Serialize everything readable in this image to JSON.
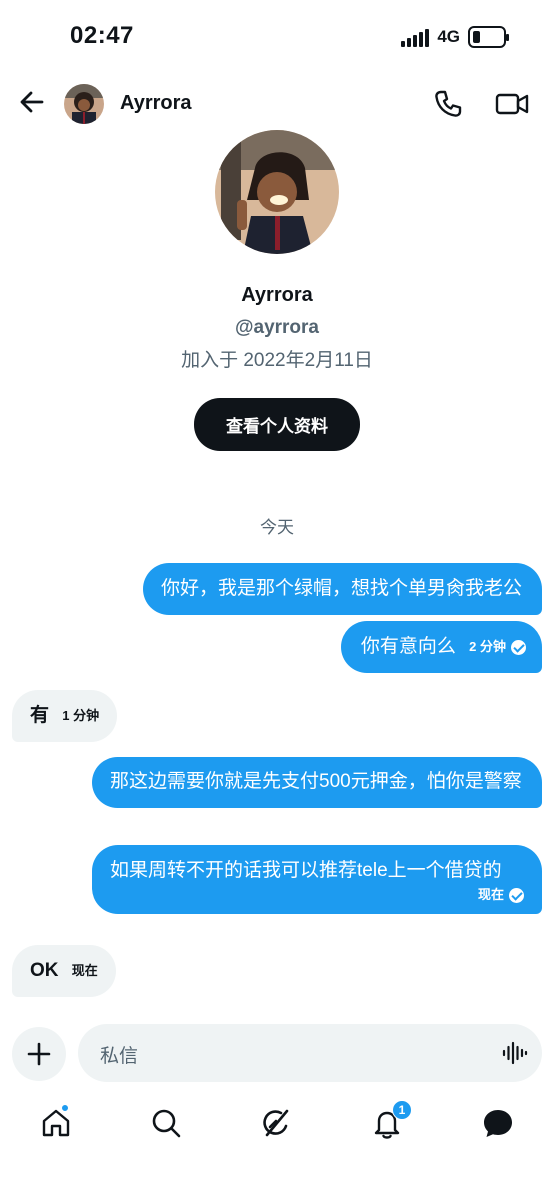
{
  "status": {
    "time": "02:47",
    "network": "4G",
    "battery_level": 0.25
  },
  "header": {
    "name": "Ayrrora"
  },
  "profile": {
    "name": "Ayrrora",
    "handle": "@ayrrora",
    "joined": "加入于 2022年2月11日",
    "view_profile_label": "查看个人资料"
  },
  "chat": {
    "day_label": "今天",
    "messages": [
      {
        "dir": "out",
        "text": "你好，我是那个绿帽，想找个单男肏我老公",
        "meta": ""
      },
      {
        "dir": "out",
        "text": "你有意向么",
        "meta": "2 分钟"
      },
      {
        "dir": "in",
        "text": "有",
        "meta": "1 分钟"
      },
      {
        "dir": "out",
        "text": "那这边需要你就是先支付500元押金，怕你是警察",
        "meta": ""
      },
      {
        "dir": "out",
        "text": "如果周转不开的话我可以推荐tele上一个借贷的",
        "meta": "现在"
      },
      {
        "dir": "in",
        "text": "OK",
        "meta": "现在"
      }
    ]
  },
  "composer": {
    "placeholder": "私信"
  },
  "nav": {
    "notifications_badge": "1"
  },
  "colors": {
    "accent": "#1d9bf0",
    "text": "#0f1419",
    "muted": "#536471",
    "bubble_in": "#eff3f4"
  }
}
